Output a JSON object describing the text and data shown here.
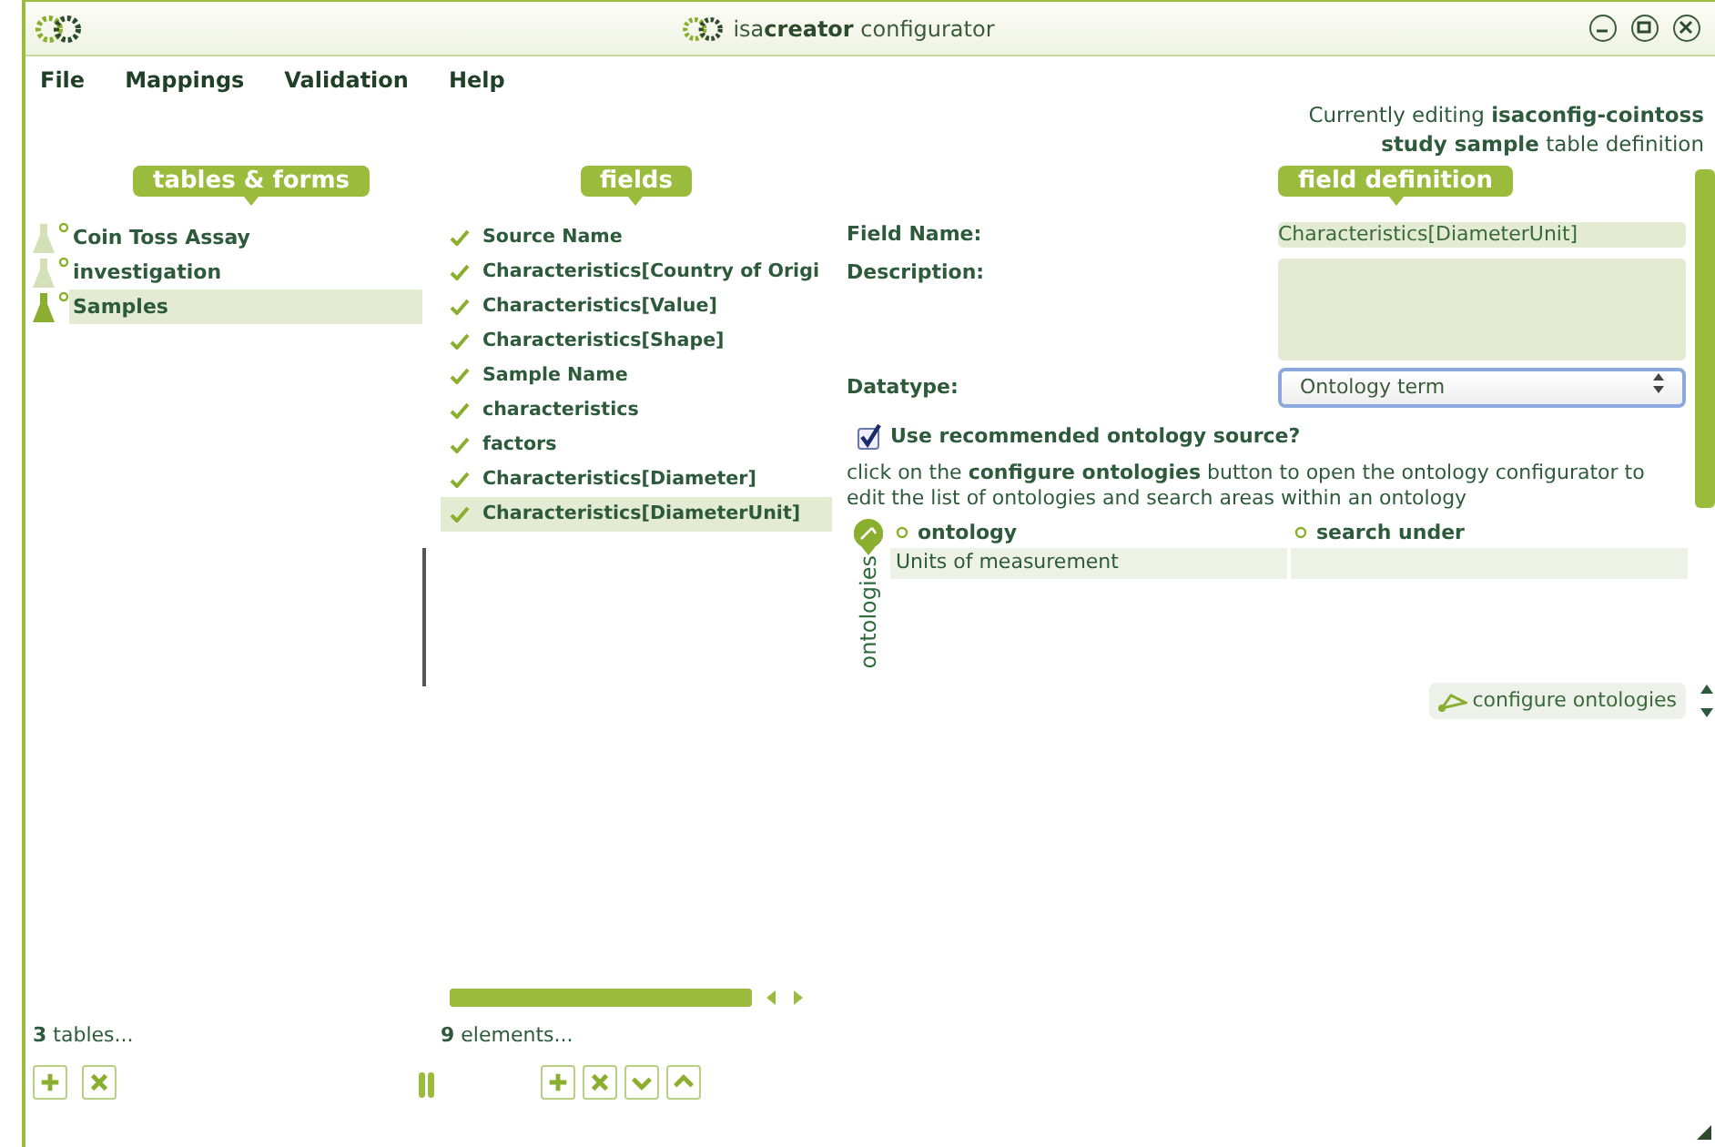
{
  "window": {
    "title": "isa**creator** configurator"
  },
  "menu": [
    "File",
    "Mappings",
    "Validation",
    "Help"
  ],
  "editing": [
    "Currently editing **isaconfig-cointoss**",
    "**study sample** table definition"
  ],
  "tables": {
    "header": "tables & forms",
    "items": [
      {
        "label": "Coin Toss Assay",
        "selected": false
      },
      {
        "label": "investigation",
        "selected": false
      },
      {
        "label": "Samples",
        "selected": true
      }
    ],
    "count": "**3** tables...",
    "buttons": [
      {
        "kind": "add"
      },
      {
        "kind": "remove"
      }
    ]
  },
  "fields": {
    "header": "fields",
    "items": [
      {
        "label": "Source Name",
        "selected": false
      },
      {
        "label": "Characteristics[Country of Origi",
        "selected": false
      },
      {
        "label": "Characteristics[Value]",
        "selected": false
      },
      {
        "label": "Characteristics[Shape]",
        "selected": false
      },
      {
        "label": "Sample Name",
        "selected": false
      },
      {
        "label": "characteristics",
        "selected": false
      },
      {
        "label": "factors",
        "selected": false
      },
      {
        "label": "Characteristics[Diameter]",
        "selected": false
      },
      {
        "label": "Characteristics[DiameterUnit]",
        "selected": true
      }
    ],
    "count": "**9** elements...",
    "buttons": [
      {
        "kind": "add"
      },
      {
        "kind": "remove"
      },
      {
        "kind": "down"
      },
      {
        "kind": "up"
      }
    ]
  },
  "definition": {
    "header": "field definition",
    "field_name": {
      "label": "Field Name:",
      "value": "Characteristics[DiameterUnit]"
    },
    "description": {
      "label": "Description:"
    },
    "datatype": {
      "label": "Datatype:",
      "value": "Ontology term"
    },
    "recommended": {
      "label": "Use recommended ontology source?",
      "checked": true
    },
    "help": "click on the **configure ontologies** button to open the ontology configurator to edit the list of ontologies and search areas within an ontology",
    "ontologies": {
      "label": "ontologies",
      "columns": [
        "ontology",
        "search under"
      ],
      "rows": [
        {
          "ontology": "Units of measurement"
        }
      ]
    },
    "configure_button": "configure ontologies"
  }
}
